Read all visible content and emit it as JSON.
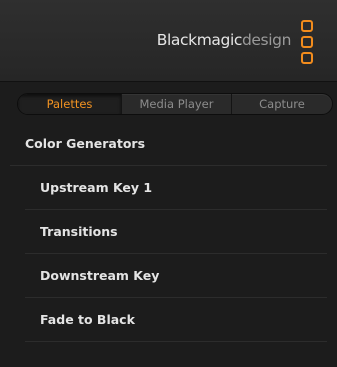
{
  "header": {
    "brand_main": "Blackmagic",
    "brand_design": "design",
    "logo_icon": "blackmagic-logo-icon",
    "accent_color": "#f28c1d"
  },
  "tabs": [
    {
      "label": "Palettes",
      "active": true
    },
    {
      "label": "Media Player",
      "active": false
    },
    {
      "label": "Capture",
      "active": false
    }
  ],
  "palettes": [
    {
      "label": "Color Generators"
    },
    {
      "label": "Upstream Key 1"
    },
    {
      "label": "Transitions"
    },
    {
      "label": "Downstream Key"
    },
    {
      "label": "Fade to Black"
    }
  ]
}
